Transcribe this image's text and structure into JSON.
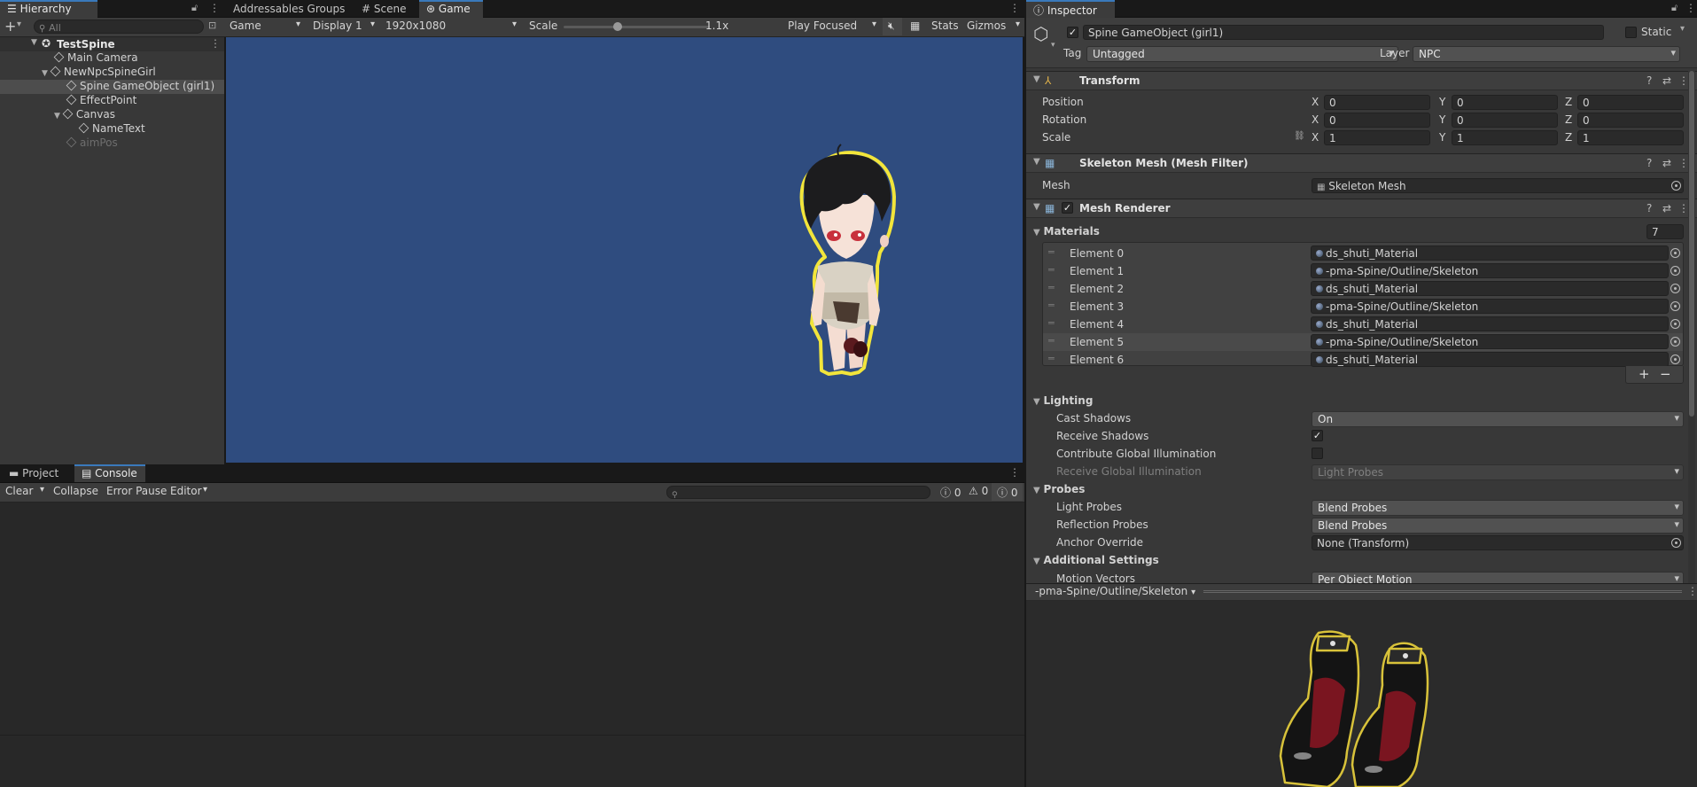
{
  "hierarchy": {
    "tab": "Hierarchy",
    "search_placeholder": "All",
    "scene": "TestSpine",
    "items": [
      "Main Camera",
      "NewNpcSpineGirl",
      "Spine GameObject (girl1)",
      "EffectPoint",
      "Canvas",
      "NameText",
      "aimPos"
    ]
  },
  "center_tabs": [
    "Addressables Groups",
    "Scene",
    "Game"
  ],
  "game_toolbar": {
    "mode": "Game",
    "display": "Display 1",
    "resolution": "1920x1080",
    "scale_label": "Scale",
    "scale_value": "1.1x",
    "play_mode": "Play Focused",
    "stats": "Stats",
    "gizmos": "Gizmos"
  },
  "bottom": {
    "tabs": [
      "Project",
      "Console"
    ],
    "clear": "Clear",
    "collapse": "Collapse",
    "error_pause": "Error Pause",
    "editor": "Editor",
    "counts": [
      "0",
      "0",
      "0"
    ]
  },
  "inspector": {
    "tab": "Inspector",
    "object_name": "Spine GameObject (girl1)",
    "static_label": "Static",
    "tag_label": "Tag",
    "tag_value": "Untagged",
    "layer_label": "Layer",
    "layer_value": "NPC",
    "transform": {
      "title": "Transform",
      "rows": [
        {
          "label": "Position",
          "x": "0",
          "y": "0",
          "z": "0"
        },
        {
          "label": "Rotation",
          "x": "0",
          "y": "0",
          "z": "0"
        },
        {
          "label": "Scale",
          "x": "1",
          "y": "1",
          "z": "1"
        }
      ],
      "axis": [
        "X",
        "Y",
        "Z"
      ]
    },
    "mesh_filter": {
      "title": "Skeleton Mesh (Mesh Filter)",
      "mesh_label": "Mesh",
      "mesh_value": "Skeleton Mesh"
    },
    "mesh_renderer": {
      "title": "Mesh Renderer",
      "materials_label": "Materials",
      "materials_count": "7",
      "elements": [
        {
          "label": "Element 0",
          "value": "ds_shuti_Material"
        },
        {
          "label": "Element 1",
          "value": "-pma-Spine/Outline/Skeleton"
        },
        {
          "label": "Element 2",
          "value": "ds_shuti_Material"
        },
        {
          "label": "Element 3",
          "value": "-pma-Spine/Outline/Skeleton"
        },
        {
          "label": "Element 4",
          "value": "ds_shuti_Material"
        },
        {
          "label": "Element 5",
          "value": "-pma-Spine/Outline/Skeleton"
        },
        {
          "label": "Element 6",
          "value": "ds_shuti_Material"
        }
      ],
      "lighting": {
        "title": "Lighting",
        "cast_shadows_label": "Cast Shadows",
        "cast_shadows_value": "On",
        "receive_shadows_label": "Receive Shadows",
        "contribute_gi_label": "Contribute Global Illumination",
        "receive_gi_label": "Receive Global Illumination",
        "receive_gi_value": "Light Probes"
      },
      "probes": {
        "title": "Probes",
        "light_probes_label": "Light Probes",
        "light_probes_value": "Blend Probes",
        "reflection_probes_label": "Reflection Probes",
        "reflection_probes_value": "Blend Probes",
        "anchor_label": "Anchor Override",
        "anchor_value": "None (Transform)"
      },
      "additional": {
        "title": "Additional Settings",
        "motion_label": "Motion Vectors",
        "motion_value": "Per Object Motion"
      }
    },
    "preview_title": "-pma-Spine/Outline/Skeleton"
  },
  "colors": {
    "game_bg": "#2f4c7f",
    "accent": "#3a79bb"
  }
}
